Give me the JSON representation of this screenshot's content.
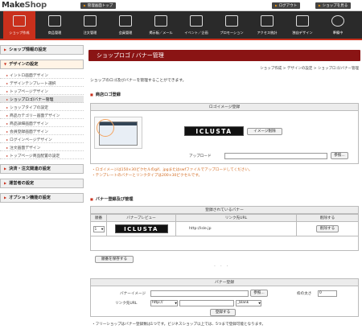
{
  "app": {
    "logo_make": "Make",
    "logo_shop": "Shop"
  },
  "toplinks": {
    "admin_top": "管理画面トップ",
    "logout": "ログアウト",
    "view_shop": "ショップを見る"
  },
  "nav": [
    {
      "label": "ショップ作成",
      "icon": "shop-create-icon"
    },
    {
      "label": "商品管理",
      "icon": "product-icon"
    },
    {
      "label": "注文管理",
      "icon": "order-icon"
    },
    {
      "label": "会員管理",
      "icon": "member-icon"
    },
    {
      "label": "掲示板／メール",
      "icon": "board-mail-icon"
    },
    {
      "label": "イベント／企画",
      "icon": "event-icon"
    },
    {
      "label": "プロモーション",
      "icon": "promotion-icon"
    },
    {
      "label": "アクセス統計",
      "icon": "statistics-icon"
    },
    {
      "label": "独自デザイン",
      "icon": "design-icon"
    },
    {
      "label": "準備中",
      "icon": "help-icon"
    }
  ],
  "sidebar": {
    "sections": {
      "shop_info": "ショップ情報の設定",
      "design": "デザインの設定",
      "payment": "決済・注文関連の設定",
      "operator": "運営者の設定",
      "options": "オプション機能の設定"
    },
    "items": [
      "イントロ画面デザイン",
      "デザインテンプレート選択",
      "トップページデザイン",
      "ショップロゴ/バナー管理",
      "ショップタイプの設定",
      "商品カテゴリー画面デザイン",
      "商品詳細画面デザイン",
      "会員登録画面デザイン",
      "ログインページデザイン",
      "注文画面デザイン",
      "トップページ商品配置の設定"
    ]
  },
  "main": {
    "title": "ショップロゴ / バナー管理",
    "breadcrumb": "ショップ作成 > デザインの設定 > ショップロゴ/バナー管理",
    "description": "ショップのロゴ及びバナーを管理することができます。",
    "logo_section": {
      "heading": "商店ロゴ登録",
      "panel_title": "ロゴイメージ登録",
      "logo_text": "ICLUSTA",
      "delete_button": "イメージ削除",
      "upload_label": "アップロード",
      "browse_button": "参照...",
      "notes": [
        "・ロゴイメージは150×30ピクセルのgif、jpgまたはswfファイルでアップロードしてください。",
        "・テンプレートのバナーとリンクタイプは200×30ピクセルです。"
      ]
    },
    "banner_section": {
      "heading": "バナー登録及び管理",
      "table_title": "登録されているバナー",
      "columns": [
        "順番",
        "バナープレビュー",
        "リンク先URL",
        "削除する"
      ],
      "rows": [
        {
          "order": "1",
          "banner_text": "ICLUSTA",
          "url": "http://isle.jp",
          "delete": "削除する"
        }
      ],
      "save_order_button": "順番を保存する",
      "register_panel_title": "バナー登録",
      "image_label": "バナーイメージ",
      "browse_button": "参照...",
      "border_label": "枠の太さ",
      "border_value": "0",
      "link_label": "リンク先URL",
      "protocol_value": "http://",
      "target_value": "_blank",
      "register_button": "登録する",
      "footer_note": "・フリーショップはバナー登録数は1つです。ビジネスショップ以上では、5つまで登録可能となります。"
    }
  },
  "colors": {
    "accent": "#8a1414",
    "nav_bg": "#2a2a2a",
    "note": "#d2691e"
  }
}
